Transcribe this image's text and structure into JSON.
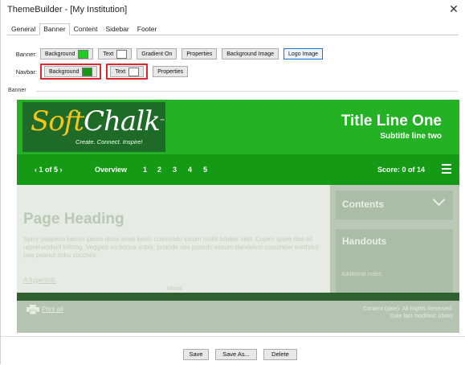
{
  "window": {
    "title": "ThemeBuilder - [My Institution]",
    "close_glyph": "✕"
  },
  "tabs": [
    "General",
    "Banner",
    "Content",
    "Sidebar",
    "Footer"
  ],
  "banner_row": {
    "label": "Banner:",
    "background_label": "Background",
    "background_color": "#22cc22",
    "text_label": "Text",
    "text_color": "#ffffff",
    "gradient_label": "Gradient On",
    "properties_label": "Properties",
    "bg_image_label": "Background Image",
    "logo_image_label": "Logo Image"
  },
  "navbar_row": {
    "label": "Navbar:",
    "background_label": "Background",
    "background_color": "#159a15",
    "text_label": "Text",
    "text_color": "#ffffff",
    "properties_label": "Properties"
  },
  "preview_group": {
    "label": "Banner"
  },
  "preview": {
    "logo": {
      "soft": "Soft",
      "chalk": "Chalk",
      "tm": "™",
      "tagline": "Create. Connect. Inspire!"
    },
    "title_line_one": "Title Line One",
    "subtitle_line_two": "Subtitle line two",
    "navbar": {
      "pager": "‹ 1 of 5 ›",
      "overview": "Overview",
      "pages": [
        "1",
        "2",
        "3",
        "4",
        "5"
      ],
      "score": "Score: 0 of 14"
    },
    "content": {
      "page_heading": "Page Heading",
      "body": "Spicy jalapeno bacon ipsum dolor amet kevin commodo ipsum mollit brisket velit. Cupim spare ribs sit reprehenderit biltong. Veggies es bonus vobis, proinde vos postulo essum dandelion cucumber earthnut pea peanut soko zucchini.",
      "hyperlink": "A hyperlink.",
      "modal": "Modal"
    },
    "sidebar": {
      "contents": "Contents",
      "handouts": "Handouts",
      "notes": "Additional notes"
    },
    "footer": {
      "print": "Print all",
      "copyright_line1": "Content (date). All Rights Reserved.",
      "copyright_line2": "Date last modified: (date)"
    }
  },
  "actions": {
    "save": "Save",
    "save_as": "Save As...",
    "delete": "Delete"
  }
}
